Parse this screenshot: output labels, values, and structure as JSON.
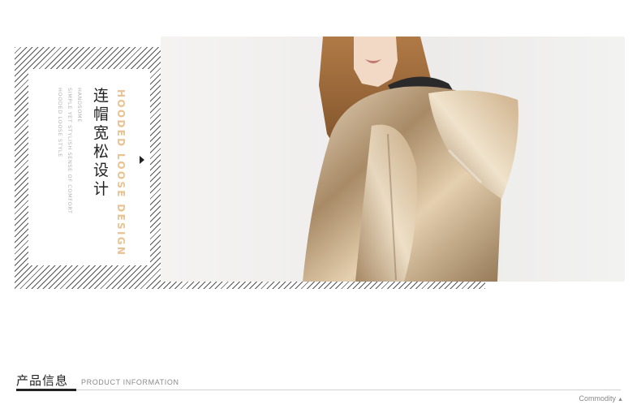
{
  "banner": {
    "title_cn": "连帽宽松设计",
    "title_en": "HOODED LOOSE DESIGN",
    "desc_lines": [
      "HOODED LOOSE STYLE",
      "SIMPLE YET STYLISH SENSE OF COMFORT",
      "HANDSOME"
    ],
    "arrow_icon": "triangle-right-icon",
    "accent_color": "#e9c290"
  },
  "section": {
    "title_cn": "产品信息",
    "title_en": "PRODUCT INFORMATION",
    "corner_label": "Commodity",
    "corner_icon": "triangle-up-icon"
  }
}
